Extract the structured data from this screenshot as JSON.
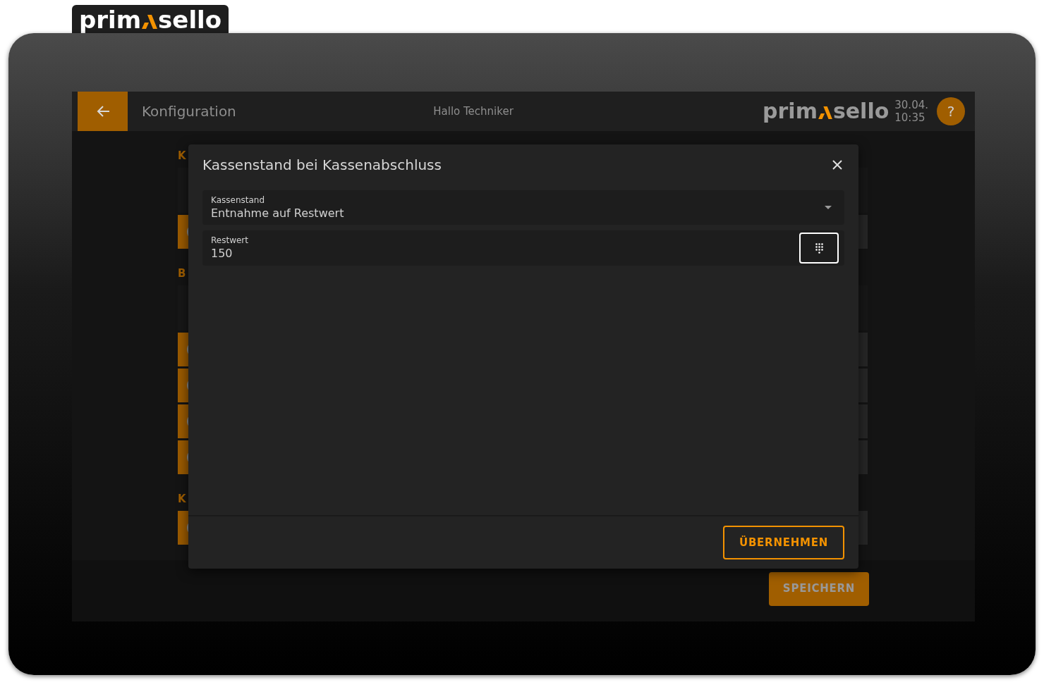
{
  "logo": {
    "left": "prim",
    "right": "sello"
  },
  "header": {
    "title": "Konfiguration",
    "greeting": "Hallo Techniker",
    "logo": {
      "left": "prim",
      "right": "sello"
    },
    "date": "30.04.",
    "time": "10:35",
    "help": "?"
  },
  "background_sections": [
    {
      "label": "K",
      "rows": [
        {
          "kind": "plain"
        },
        {
          "kind": "tile"
        }
      ]
    },
    {
      "label": "B",
      "rows": [
        {
          "kind": "plain"
        },
        {
          "kind": "tile"
        },
        {
          "kind": "tile"
        },
        {
          "kind": "tile"
        },
        {
          "kind": "tile"
        }
      ]
    },
    {
      "label": "K",
      "rows": [
        {
          "kind": "tile"
        }
      ]
    }
  ],
  "save_button": "SPEICHERN",
  "dialog": {
    "title": "Kassenstand bei Kassenabschluss",
    "fields": [
      {
        "kind": "select",
        "label": "Kassenstand",
        "value": "Entnahme auf Restwert"
      },
      {
        "kind": "number",
        "label": "Restwert",
        "value": "150"
      }
    ],
    "apply_button": "ÜBERNEHMEN"
  }
}
